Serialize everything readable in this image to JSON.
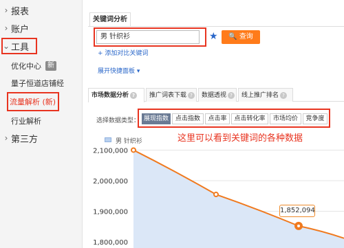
{
  "sidebar": {
    "items": [
      {
        "label": "报表"
      },
      {
        "label": "账户"
      },
      {
        "label": "工具"
      },
      {
        "label": "优化中心",
        "badge": "新"
      },
      {
        "label": "量子恒道店铺经"
      },
      {
        "label": "流量解析 (新)"
      },
      {
        "label": "行业解析"
      },
      {
        "label": "第三方"
      }
    ]
  },
  "keyword": {
    "section_tab": "关键词分析",
    "input_value": "男 针织衫",
    "query_label": "查询",
    "add_compare": "添加对比关键词",
    "expand_panel": "展开快捷面板"
  },
  "tabs": [
    {
      "label": "市场数据分析"
    },
    {
      "label": "推广词表下载"
    },
    {
      "label": "数据透视"
    },
    {
      "label": "线上推广排名"
    }
  ],
  "data_types": {
    "label": "选择数据类型：",
    "options": [
      "展现指数",
      "点击指数",
      "点击率",
      "点击转化率",
      "市场均价",
      "竞争度"
    ],
    "selected": "展现指数"
  },
  "annotation": "这里可以看到关键词的各种数据",
  "colors": {
    "accent": "#ff7b1a",
    "highlight": "#e8331f",
    "link": "#2a67c9"
  },
  "chart_data": {
    "type": "area",
    "series": [
      {
        "name": "男 针织衫",
        "values": [
          2100000,
          1955000,
          1852094,
          1812000
        ]
      }
    ],
    "y_ticks": [
      "2,100,000",
      "2,000,000",
      "1,900,000",
      "1,800,000"
    ],
    "ylim": [
      1780000,
      2110000
    ],
    "tooltip": "1,852,094"
  }
}
